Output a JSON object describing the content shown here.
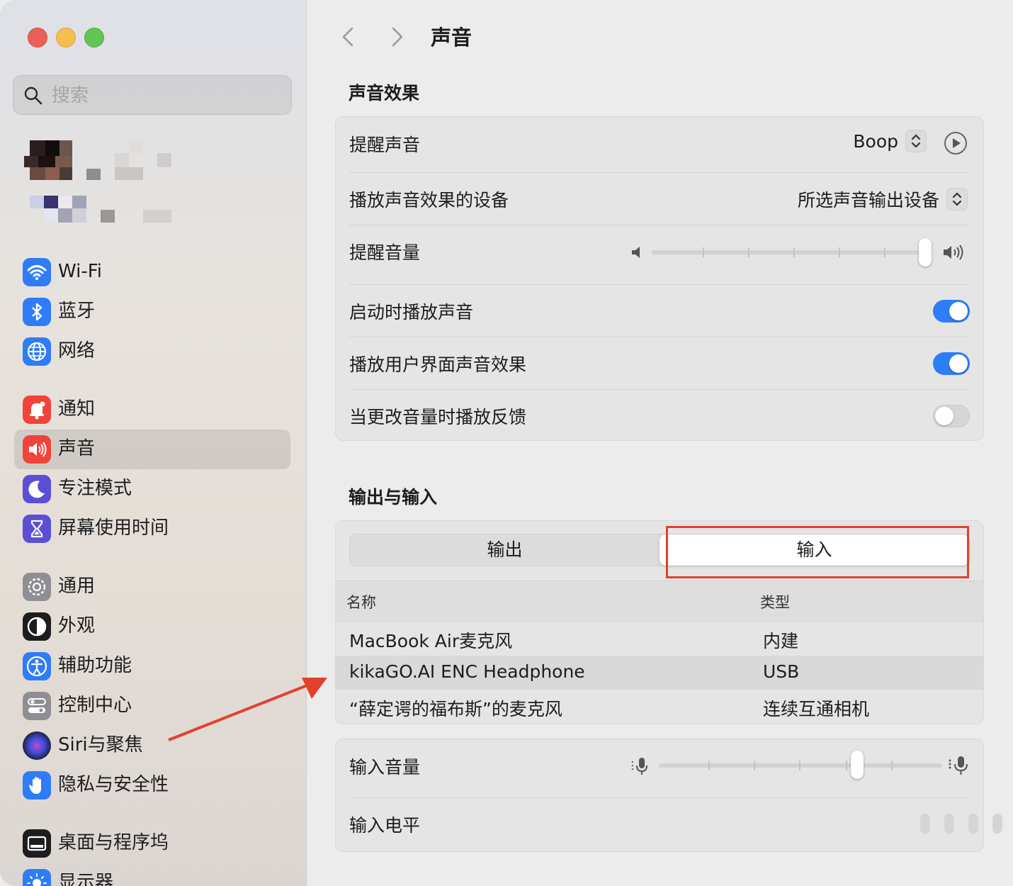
{
  "colors": {
    "accent": "#2d7df6",
    "annotation": "#e2412b"
  },
  "sidebar": {
    "search_placeholder": "搜索",
    "items": [
      {
        "label": "Wi-Fi",
        "icon": "wifi-icon",
        "color": "#2f7cf6"
      },
      {
        "label": "蓝牙",
        "icon": "bluetooth-icon",
        "color": "#2f7cf6"
      },
      {
        "label": "网络",
        "icon": "globe-icon",
        "color": "#2f7cf6"
      },
      {
        "label": "通知",
        "icon": "bell-icon",
        "color": "#f0443a"
      },
      {
        "label": "声音",
        "icon": "speaker-icon",
        "color": "#f0443a",
        "active": true
      },
      {
        "label": "专注模式",
        "icon": "moon-icon",
        "color": "#5b4fd6"
      },
      {
        "label": "屏幕使用时间",
        "icon": "hourglass-icon",
        "color": "#5b4fd6"
      },
      {
        "label": "通用",
        "icon": "gear-icon",
        "color": "#8e8e93"
      },
      {
        "label": "外观",
        "icon": "appearance-icon",
        "color": "#1d1d1f"
      },
      {
        "label": "辅助功能",
        "icon": "accessibility-icon",
        "color": "#2f7cf6"
      },
      {
        "label": "控制中心",
        "icon": "control-center-icon",
        "color": "#8e8e93"
      },
      {
        "label": "Siri与聚焦",
        "icon": "siri-icon",
        "color": "#333333"
      },
      {
        "label": "隐私与安全性",
        "icon": "hand-icon",
        "color": "#2f7cf6"
      },
      {
        "label": "桌面与程序坞",
        "icon": "dock-icon",
        "color": "#1d1d1f"
      },
      {
        "label": "显示器",
        "icon": "sun-icon",
        "color": "#2f7cf6"
      }
    ]
  },
  "header": {
    "title": "声音"
  },
  "sound_effects": {
    "section_title": "声音效果",
    "alert_sound_label": "提醒声音",
    "alert_sound_value": "Boop",
    "play_device_label": "播放声音效果的设备",
    "play_device_value": "所选声音输出设备",
    "alert_volume_label": "提醒音量",
    "alert_volume_level": 1.0,
    "startup_sound_label": "启动时播放声音",
    "startup_sound_on": true,
    "ui_sound_label": "播放用户界面声音效果",
    "ui_sound_on": true,
    "feedback_label": "当更改音量时播放反馈",
    "feedback_on": false
  },
  "output_input": {
    "section_title": "输出与输入",
    "tabs": [
      "输出",
      "输入"
    ],
    "selected_tab": "输入",
    "columns": [
      "名称",
      "类型"
    ],
    "devices": [
      {
        "name": "MacBook Air麦克风",
        "type": "内建"
      },
      {
        "name": "kikaGO.AI ENC Headphone",
        "type": "USB",
        "selected": true
      },
      {
        "name": "“薛定谔的福布斯”的麦克风",
        "type": "连续互通相机"
      }
    ],
    "input_volume_label": "输入音量",
    "input_volume_level": 0.7,
    "input_level_label": "输入电平",
    "input_level_value": 0
  }
}
